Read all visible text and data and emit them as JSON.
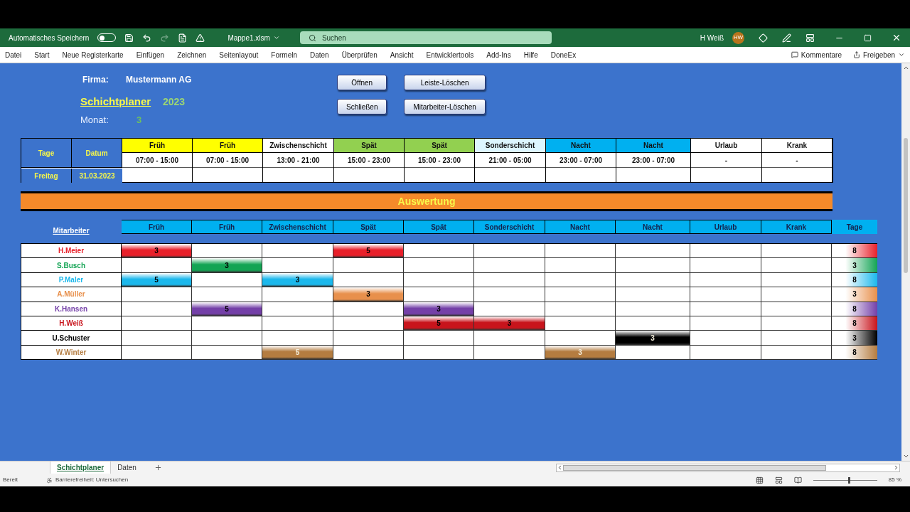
{
  "title_bar": {
    "autosave_label": "Automatisches Speichern",
    "autosave_on": false,
    "file_name": "Mappe1.xlsm",
    "search_placeholder": "Suchen",
    "user_name": "H Weiß",
    "user_initials": "HW"
  },
  "ribbon_tabs": [
    "Datei",
    "Start",
    "Neue Registerkarte",
    "Einfügen",
    "Zeichnen",
    "Seitenlayout",
    "Formeln",
    "Daten",
    "Überprüfen",
    "Ansicht",
    "Entwicklertools",
    "Add-Ins",
    "Hilfe",
    "DoneEx"
  ],
  "ribbon_actions": [
    "Kommentare",
    "Freigeben"
  ],
  "sheet": {
    "company_label": "Firma:",
    "company": "Mustermann AG",
    "title": "Schichtplaner",
    "year": "2023",
    "month_label": "Monat:",
    "month": "3",
    "buttons": [
      [
        "Öffnen",
        "Schließen"
      ],
      [
        "Leiste-Löschen",
        "Mitarbeiter-Löschen"
      ]
    ],
    "plan": {
      "day_header": "Tage",
      "date_header": "Datum",
      "day": "Freitag",
      "date": "31.03.2023",
      "shifts": [
        {
          "name": "Früh",
          "time": "07:00 - 15:00",
          "color": "#ffff00"
        },
        {
          "name": "Früh",
          "time": "07:00 - 15:00",
          "color": "#ffff00"
        },
        {
          "name": "Zwischenschicht",
          "time": "13:00 - 21:00",
          "color": "#ffffff"
        },
        {
          "name": "Spät",
          "time": "15:00 - 23:00",
          "color": "#92d050"
        },
        {
          "name": "Spät",
          "time": "15:00 - 23:00",
          "color": "#92d050"
        },
        {
          "name": "Sonderschicht",
          "time": "21:00 - 05:00",
          "color": "#ddf6ff"
        },
        {
          "name": "Nacht",
          "time": "23:00 - 07:00",
          "color": "#00b0f0"
        },
        {
          "name": "Nacht",
          "time": "23:00 - 07:00",
          "color": "#00b0f0"
        },
        {
          "name": "Urlaub",
          "time": "-",
          "color": "#ffffff"
        },
        {
          "name": "Krank",
          "time": "-",
          "color": "#ffffff"
        }
      ]
    },
    "summary_title": "Auswertung",
    "summary": {
      "employee_header": "Mitarbeiter",
      "columns": [
        "Früh",
        "Früh",
        "Zwischenschicht",
        "Spät",
        "Spät",
        "Sonderschicht",
        "Nacht",
        "Nacht",
        "Urlaub",
        "Krank"
      ],
      "total_header": "Tage",
      "rows": [
        {
          "name": "H.Meier",
          "color": "#e8202a",
          "light_text": false,
          "cells": [
            "3",
            null,
            null,
            "5",
            null,
            null,
            null,
            null,
            null,
            null
          ],
          "total": "8"
        },
        {
          "name": "S.Busch",
          "color": "#13a454",
          "light_text": false,
          "cells": [
            null,
            "3",
            null,
            null,
            null,
            null,
            null,
            null,
            null,
            null
          ],
          "total": "3"
        },
        {
          "name": "P.Maler",
          "color": "#1cb8ec",
          "light_text": false,
          "cells": [
            "5",
            null,
            "3",
            null,
            null,
            null,
            null,
            null,
            null,
            null
          ],
          "total": "8"
        },
        {
          "name": "A.Müller",
          "color": "#e8904c",
          "light_text": false,
          "cells": [
            null,
            null,
            null,
            "3",
            null,
            null,
            null,
            null,
            null,
            null
          ],
          "total": "3"
        },
        {
          "name": "K.Hansen",
          "color": "#7440a8",
          "light_text": false,
          "cells": [
            null,
            "5",
            null,
            null,
            "3",
            null,
            null,
            null,
            null,
            null
          ],
          "total": "8"
        },
        {
          "name": "H.Weiß",
          "color": "#c8141c",
          "light_text": false,
          "cells": [
            null,
            null,
            null,
            null,
            "5",
            "3",
            null,
            null,
            null,
            null
          ],
          "total": "8"
        },
        {
          "name": "U.Schuster",
          "color": "#000000",
          "light_text": true,
          "cells": [
            null,
            null,
            null,
            null,
            null,
            null,
            null,
            "3",
            null,
            null
          ],
          "total": "3"
        },
        {
          "name": "W.Winter",
          "color": "#b47c40",
          "light_text": true,
          "cells": [
            null,
            null,
            "5",
            null,
            null,
            null,
            "3",
            null,
            null,
            null
          ],
          "total": "8"
        }
      ]
    }
  },
  "sheet_tabs": [
    {
      "label": "Schichtplaner",
      "selected": true
    },
    {
      "label": "Daten",
      "selected": false
    }
  ],
  "status_bar": {
    "ready": "Bereit",
    "accessibility": "Barrierefreiheit: Untersuchen",
    "zoom": "85 %",
    "zoom_slider": {
      "level": 0.55
    }
  }
}
